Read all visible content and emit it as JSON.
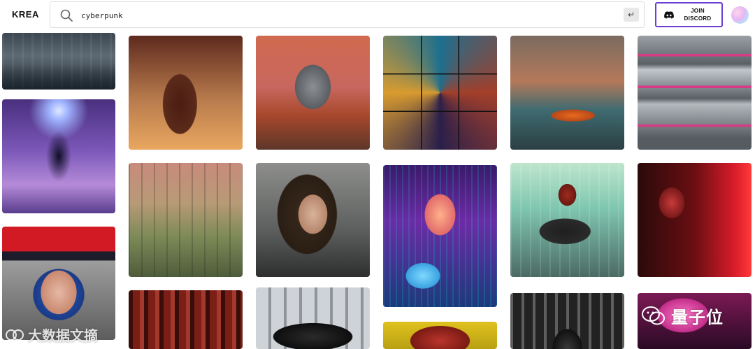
{
  "app": {
    "logo": "KREA"
  },
  "search": {
    "query": "cyberpunk",
    "enter_glyph": "↵",
    "icon": "search-icon"
  },
  "header": {
    "discord_label_line1": "JOIN",
    "discord_label_line2": "DISCORD",
    "discord_icon": "discord-icon",
    "avatar": "avatar"
  },
  "gallery": {
    "images": [
      {
        "name": "image-cyberpunk-city-bridge"
      },
      {
        "name": "image-neon-android-woman"
      },
      {
        "name": "image-lincoln-portrait"
      },
      {
        "name": "image-anubis-warrior"
      },
      {
        "name": "image-industrial-structure"
      },
      {
        "name": "image-red-forest"
      },
      {
        "name": "image-masked-warrior"
      },
      {
        "name": "image-woman-portrait"
      },
      {
        "name": "image-sports-car"
      },
      {
        "name": "image-city-collage"
      },
      {
        "name": "image-glitch-face"
      },
      {
        "name": "image-octopus"
      },
      {
        "name": "image-rower-boat"
      },
      {
        "name": "image-motorcycle-rider"
      },
      {
        "name": "image-tunnel-robot"
      },
      {
        "name": "image-car-concepts"
      },
      {
        "name": "image-red-robot"
      },
      {
        "name": "image-pink-neon"
      }
    ]
  },
  "watermarks": {
    "left_text": "大数据文摘",
    "right_text": "量子位"
  }
}
